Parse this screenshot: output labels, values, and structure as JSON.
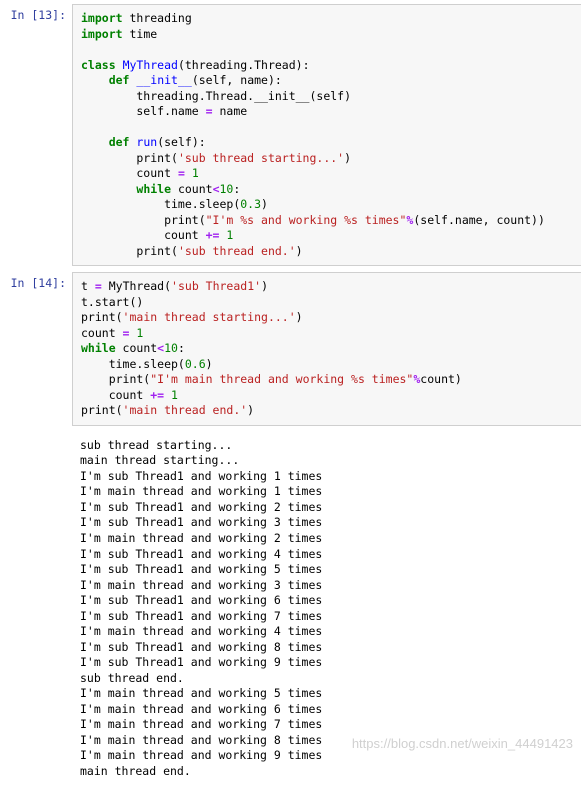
{
  "cells": {
    "c13": {
      "prompt": "In [13]:",
      "code": [
        {
          "t": "kw",
          "v": "import"
        },
        {
          "t": "p",
          "v": " threading\n"
        },
        {
          "t": "kw",
          "v": "import"
        },
        {
          "t": "p",
          "v": " time\n\n"
        },
        {
          "t": "kw",
          "v": "class"
        },
        {
          "t": "p",
          "v": " "
        },
        {
          "t": "cls",
          "v": "MyThread"
        },
        {
          "t": "p",
          "v": "(threading.Thread):\n"
        },
        {
          "t": "p",
          "v": "    "
        },
        {
          "t": "kw",
          "v": "def"
        },
        {
          "t": "p",
          "v": " "
        },
        {
          "t": "fn",
          "v": "__init__"
        },
        {
          "t": "p",
          "v": "(self, name):\n"
        },
        {
          "t": "p",
          "v": "        threading.Thread.__init__(self)\n"
        },
        {
          "t": "p",
          "v": "        self.name "
        },
        {
          "t": "op",
          "v": "="
        },
        {
          "t": "p",
          "v": " name\n\n"
        },
        {
          "t": "p",
          "v": "    "
        },
        {
          "t": "kw",
          "v": "def"
        },
        {
          "t": "p",
          "v": " "
        },
        {
          "t": "fn",
          "v": "run"
        },
        {
          "t": "p",
          "v": "(self):\n"
        },
        {
          "t": "p",
          "v": "        print("
        },
        {
          "t": "str",
          "v": "'sub thread starting...'"
        },
        {
          "t": "p",
          "v": ")\n"
        },
        {
          "t": "p",
          "v": "        count "
        },
        {
          "t": "op",
          "v": "="
        },
        {
          "t": "p",
          "v": " "
        },
        {
          "t": "num",
          "v": "1"
        },
        {
          "t": "p",
          "v": "\n"
        },
        {
          "t": "p",
          "v": "        "
        },
        {
          "t": "kw",
          "v": "while"
        },
        {
          "t": "p",
          "v": " count"
        },
        {
          "t": "op",
          "v": "<"
        },
        {
          "t": "num",
          "v": "10"
        },
        {
          "t": "p",
          "v": ":\n"
        },
        {
          "t": "p",
          "v": "            time.sleep("
        },
        {
          "t": "num",
          "v": "0.3"
        },
        {
          "t": "p",
          "v": ")\n"
        },
        {
          "t": "p",
          "v": "            print("
        },
        {
          "t": "str",
          "v": "\"I'm %s and working %s times\""
        },
        {
          "t": "op",
          "v": "%"
        },
        {
          "t": "p",
          "v": "(self.name, count))\n"
        },
        {
          "t": "p",
          "v": "            count "
        },
        {
          "t": "op",
          "v": "+="
        },
        {
          "t": "p",
          "v": " "
        },
        {
          "t": "num",
          "v": "1"
        },
        {
          "t": "p",
          "v": "\n"
        },
        {
          "t": "p",
          "v": "        print("
        },
        {
          "t": "str",
          "v": "'sub thread end.'"
        },
        {
          "t": "p",
          "v": ")"
        }
      ]
    },
    "c14": {
      "prompt": "In [14]:",
      "code": [
        {
          "t": "p",
          "v": "t "
        },
        {
          "t": "op",
          "v": "="
        },
        {
          "t": "p",
          "v": " MyThread("
        },
        {
          "t": "str",
          "v": "'sub Thread1'"
        },
        {
          "t": "p",
          "v": ")\n"
        },
        {
          "t": "p",
          "v": "t.start()\n"
        },
        {
          "t": "p",
          "v": "print("
        },
        {
          "t": "str",
          "v": "'main thread starting...'"
        },
        {
          "t": "p",
          "v": ")\n"
        },
        {
          "t": "p",
          "v": "count "
        },
        {
          "t": "op",
          "v": "="
        },
        {
          "t": "p",
          "v": " "
        },
        {
          "t": "num",
          "v": "1"
        },
        {
          "t": "p",
          "v": "\n"
        },
        {
          "t": "kw",
          "v": "while"
        },
        {
          "t": "p",
          "v": " count"
        },
        {
          "t": "op",
          "v": "<"
        },
        {
          "t": "num",
          "v": "10"
        },
        {
          "t": "p",
          "v": ":\n"
        },
        {
          "t": "p",
          "v": "    time.sleep("
        },
        {
          "t": "num",
          "v": "0.6"
        },
        {
          "t": "p",
          "v": ")\n"
        },
        {
          "t": "p",
          "v": "    print("
        },
        {
          "t": "str",
          "v": "\"I'm main thread and working %s times\""
        },
        {
          "t": "op",
          "v": "%"
        },
        {
          "t": "p",
          "v": "count)\n"
        },
        {
          "t": "p",
          "v": "    count "
        },
        {
          "t": "op",
          "v": "+="
        },
        {
          "t": "p",
          "v": " "
        },
        {
          "t": "num",
          "v": "1"
        },
        {
          "t": "p",
          "v": "\n"
        },
        {
          "t": "p",
          "v": "print("
        },
        {
          "t": "str",
          "v": "'main thread end.'"
        },
        {
          "t": "p",
          "v": ")"
        }
      ],
      "output": "sub thread starting...\nmain thread starting...\nI'm sub Thread1 and working 1 times\nI'm main thread and working 1 times\nI'm sub Thread1 and working 2 times\nI'm sub Thread1 and working 3 times\nI'm main thread and working 2 times\nI'm sub Thread1 and working 4 times\nI'm sub Thread1 and working 5 times\nI'm main thread and working 3 times\nI'm sub Thread1 and working 6 times\nI'm sub Thread1 and working 7 times\nI'm main thread and working 4 times\nI'm sub Thread1 and working 8 times\nI'm sub Thread1 and working 9 times\nsub thread end.\nI'm main thread and working 5 times\nI'm main thread and working 6 times\nI'm main thread and working 7 times\nI'm main thread and working 8 times\nI'm main thread and working 9 times\nmain thread end."
    }
  },
  "watermark": "https://blog.csdn.net/weixin_44491423"
}
